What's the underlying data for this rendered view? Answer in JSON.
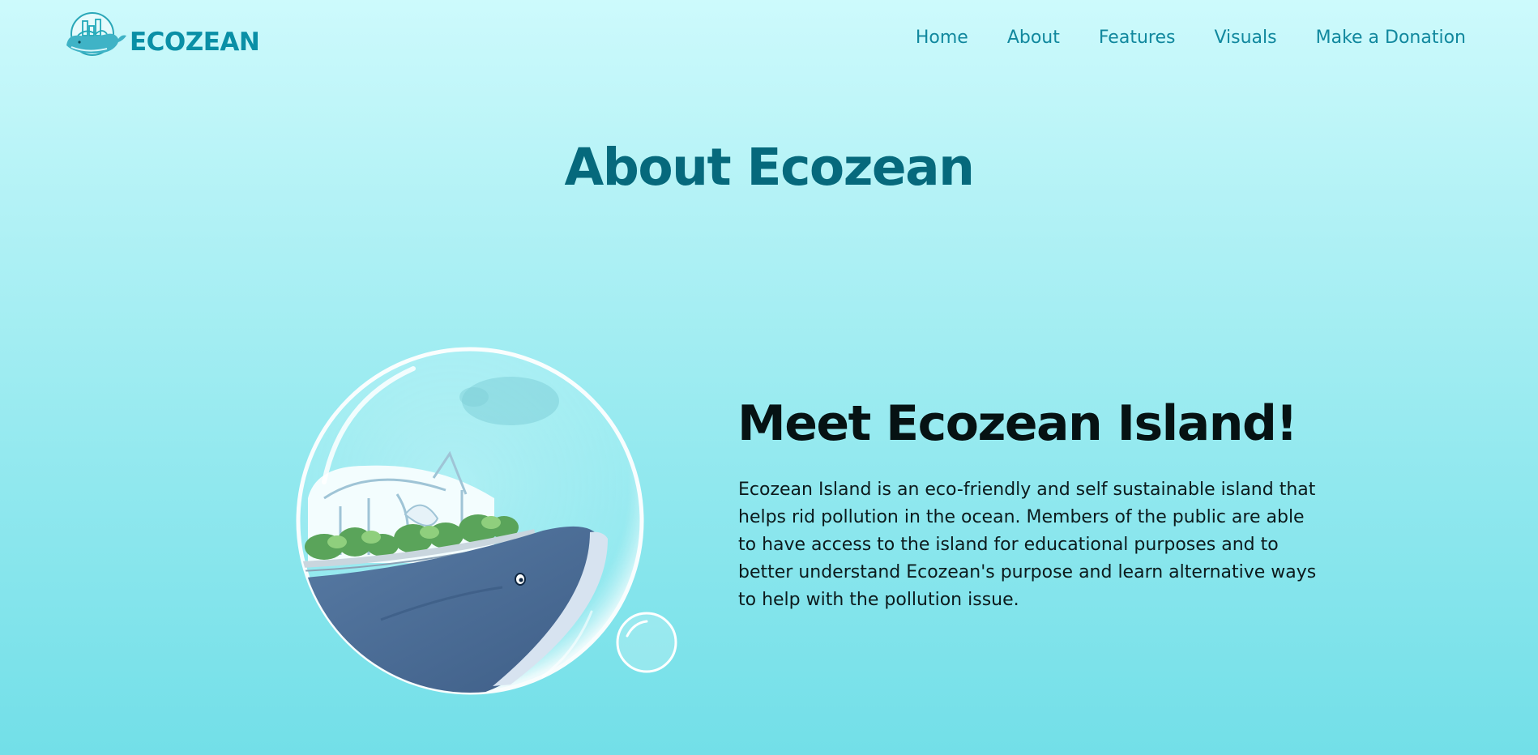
{
  "header": {
    "logo_text": "ECOZEAN",
    "nav": [
      {
        "label": "Home"
      },
      {
        "label": "About"
      },
      {
        "label": "Features"
      },
      {
        "label": "Visuals"
      },
      {
        "label": "Make a Donation"
      }
    ]
  },
  "main": {
    "title": "About Ecozean",
    "hero": {
      "heading": "Meet Ecozean Island!",
      "body": "Ecozean Island is an eco-friendly and self sustainable island that helps rid pollution in the ocean. Members of the public are able to have access to the island for educational purposes and to better understand Ecozean's purpose and learn alternative ways to help with the pollution issue.",
      "illustration": "whale-island-bubble-illustration"
    }
  },
  "colors": {
    "brand": "#0a8fa6",
    "nav_link": "#11889e",
    "title": "#06697c",
    "background_top": "#cdfafc",
    "background_bottom": "#72dfe8"
  }
}
